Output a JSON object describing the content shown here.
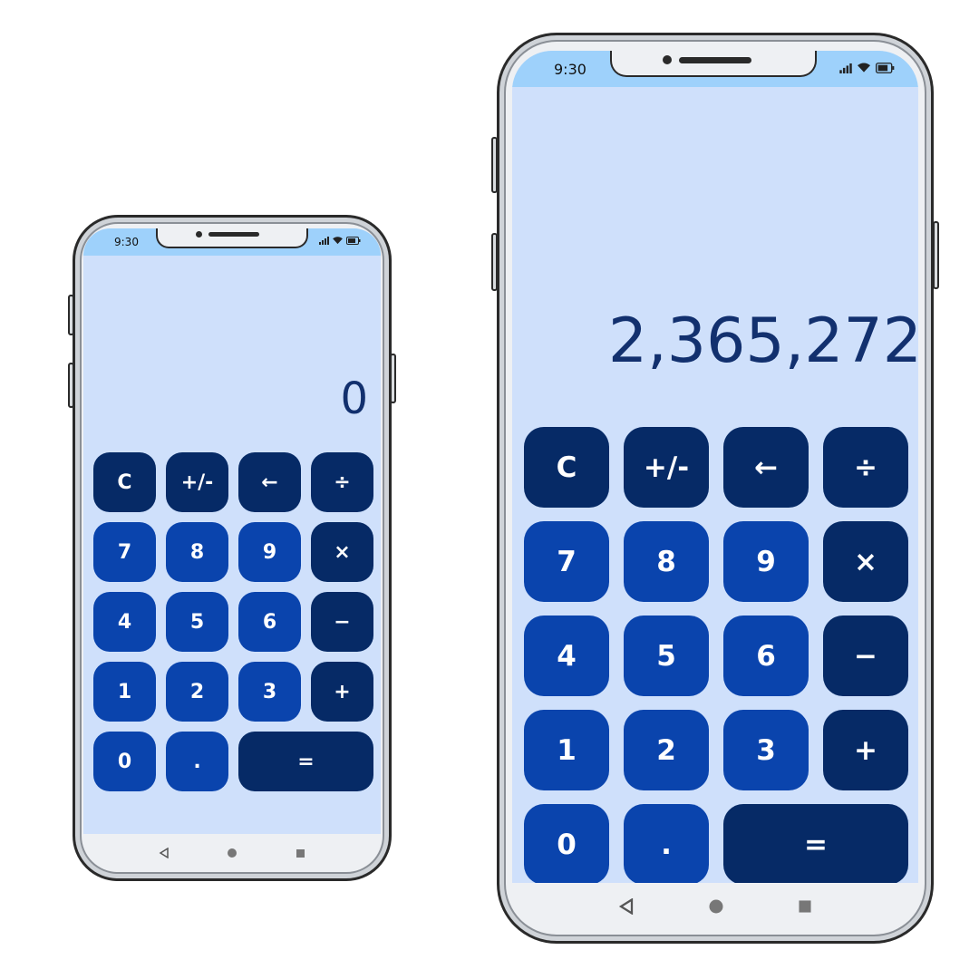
{
  "colors": {
    "screen_bg": "#cfe0fb",
    "statusbar_bg": "#9ed1fb",
    "number_key": "#0a44ad",
    "operator_key": "#062a66",
    "display_text": "#12306e"
  },
  "phones": {
    "small": {
      "status": {
        "time": "9:30"
      },
      "display": "0",
      "keys": [
        {
          "label": "C",
          "kind": "op"
        },
        {
          "label": "+/-",
          "kind": "op"
        },
        {
          "label": "←",
          "kind": "op"
        },
        {
          "label": "÷",
          "kind": "op"
        },
        {
          "label": "7",
          "kind": "num"
        },
        {
          "label": "8",
          "kind": "num"
        },
        {
          "label": "9",
          "kind": "num"
        },
        {
          "label": "×",
          "kind": "op"
        },
        {
          "label": "4",
          "kind": "num"
        },
        {
          "label": "5",
          "kind": "num"
        },
        {
          "label": "6",
          "kind": "num"
        },
        {
          "label": "−",
          "kind": "op"
        },
        {
          "label": "1",
          "kind": "num"
        },
        {
          "label": "2",
          "kind": "num"
        },
        {
          "label": "3",
          "kind": "num"
        },
        {
          "label": "+",
          "kind": "op"
        },
        {
          "label": "0",
          "kind": "num"
        },
        {
          "label": ".",
          "kind": "num"
        },
        {
          "label": "=",
          "kind": "op"
        }
      ]
    },
    "large": {
      "status": {
        "time": "9:30"
      },
      "display": "2,365,272",
      "keys": [
        {
          "label": "C",
          "kind": "op"
        },
        {
          "label": "+/-",
          "kind": "op"
        },
        {
          "label": "←",
          "kind": "op"
        },
        {
          "label": "÷",
          "kind": "op"
        },
        {
          "label": "7",
          "kind": "num"
        },
        {
          "label": "8",
          "kind": "num"
        },
        {
          "label": "9",
          "kind": "num"
        },
        {
          "label": "×",
          "kind": "op"
        },
        {
          "label": "4",
          "kind": "num"
        },
        {
          "label": "5",
          "kind": "num"
        },
        {
          "label": "6",
          "kind": "num"
        },
        {
          "label": "−",
          "kind": "op"
        },
        {
          "label": "1",
          "kind": "num"
        },
        {
          "label": "2",
          "kind": "num"
        },
        {
          "label": "3",
          "kind": "num"
        },
        {
          "label": "+",
          "kind": "op"
        },
        {
          "label": "0",
          "kind": "num"
        },
        {
          "label": ".",
          "kind": "num"
        },
        {
          "label": "=",
          "kind": "op"
        }
      ]
    }
  },
  "icons": {
    "status": [
      "signal-icon",
      "wifi-icon",
      "battery-icon"
    ],
    "nav": [
      "back-icon",
      "home-icon",
      "recents-icon"
    ]
  }
}
